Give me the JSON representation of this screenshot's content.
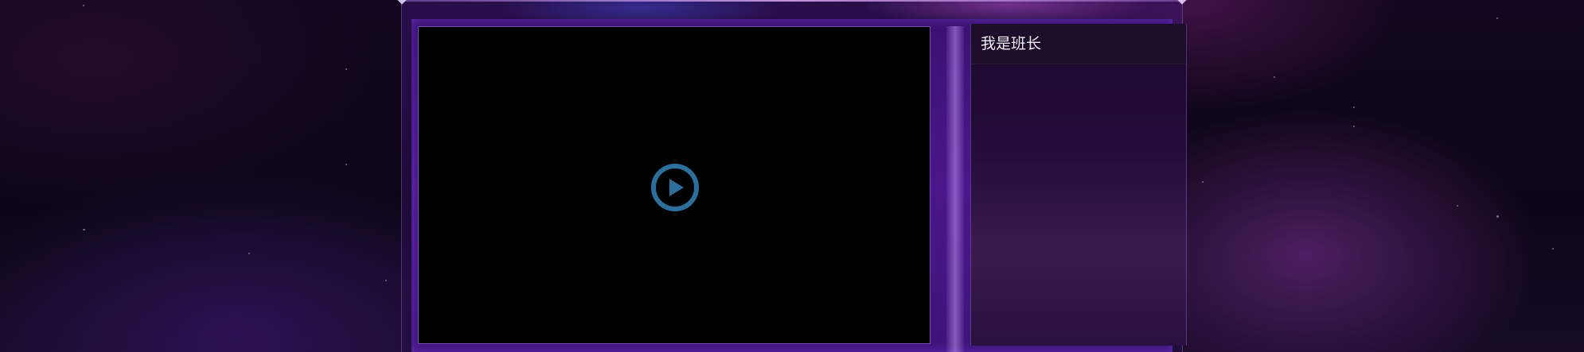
{
  "side_panel": {
    "title": "我是班长"
  },
  "player": {
    "play_icon": "play-circle-icon",
    "accent_color": "#2c6e9c"
  },
  "theme": {
    "background": "#0c0516",
    "frame_color": "#4a178a"
  }
}
